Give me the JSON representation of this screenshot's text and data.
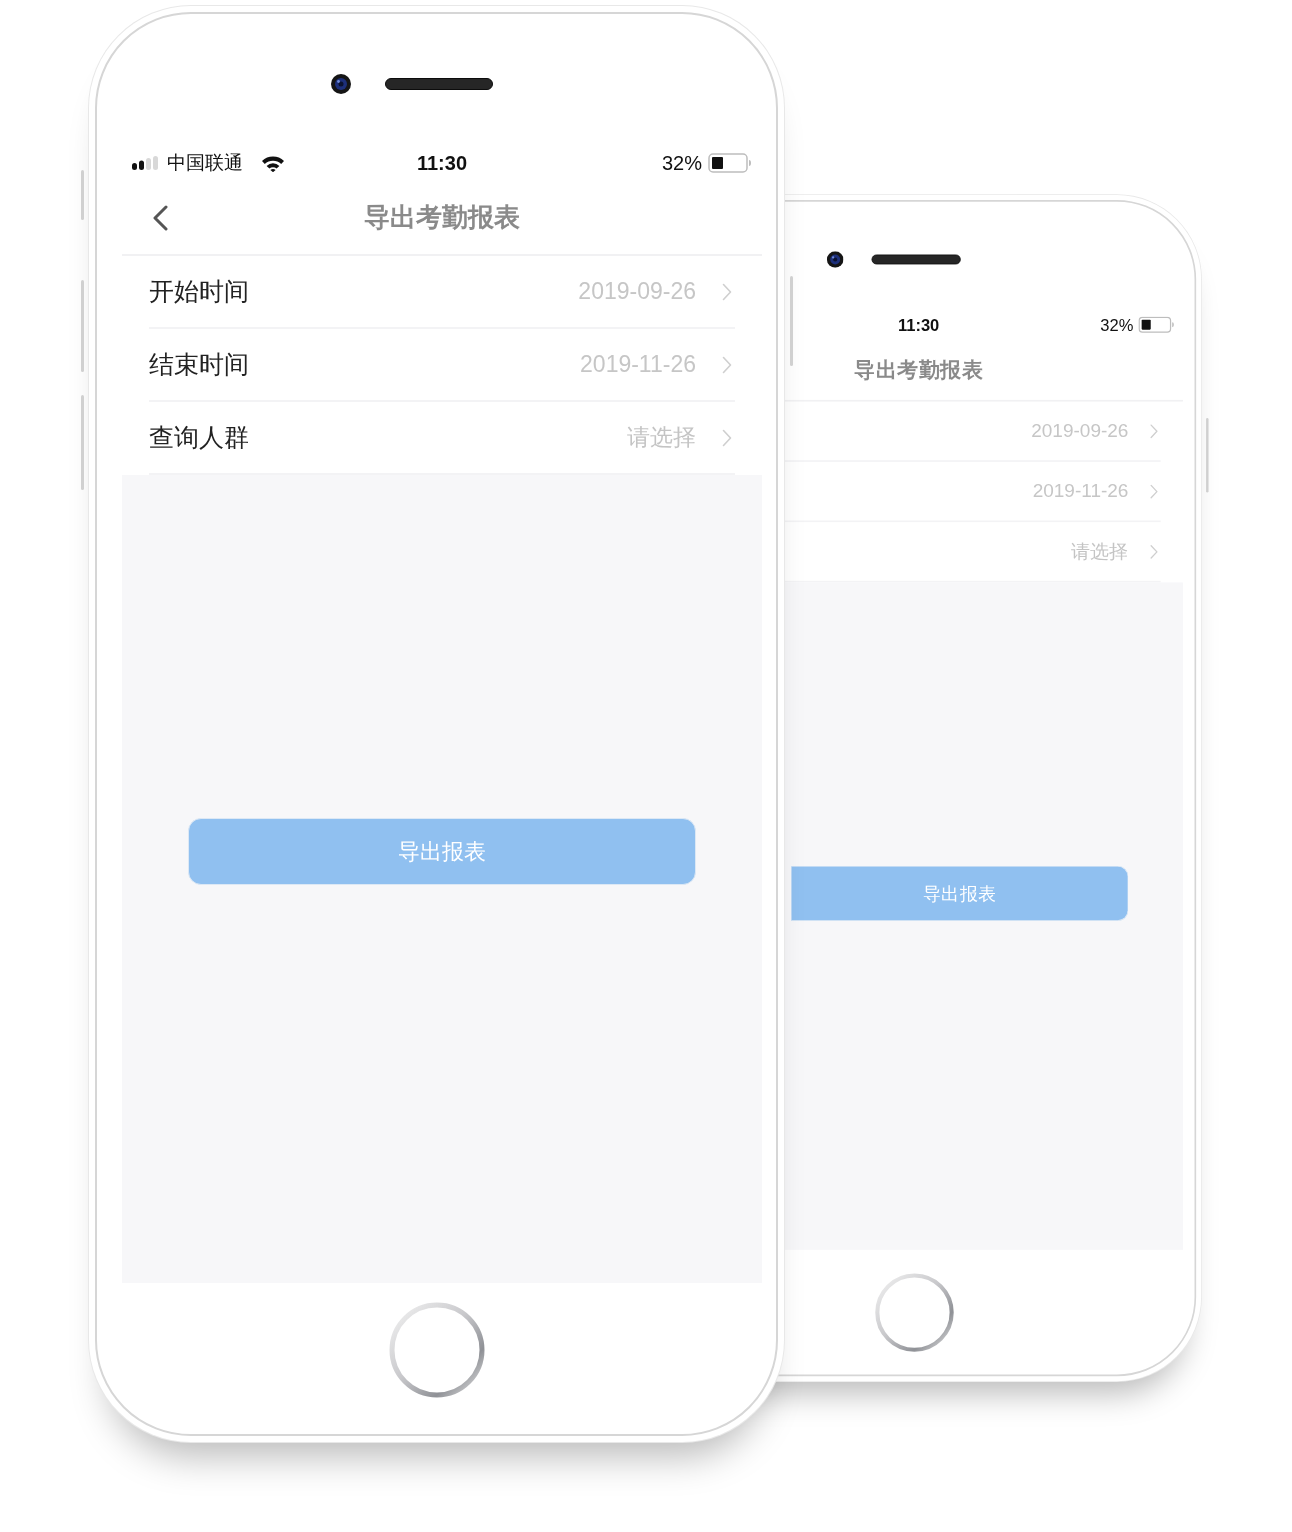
{
  "phones": [
    {
      "kind": "front",
      "status_bar": {
        "carrier": "中国联通",
        "time": "11:30",
        "battery": "32%"
      },
      "nav_bar": {
        "back": true,
        "title": "导出考勤报表"
      },
      "rows": [
        {
          "label": "开始时间",
          "value": "2019-09-26"
        },
        {
          "label": "结束时间",
          "value": "2019-11-26"
        },
        {
          "label": "查询人群",
          "placeholder": "请选择"
        }
      ],
      "button": "导出报表"
    },
    {
      "kind": "rear",
      "status_bar": {
        "time": "11:30",
        "battery": "32%"
      },
      "nav_bar": {
        "title": "导出考勤报表"
      },
      "rows": [
        {
          "value": "2019-09-26"
        },
        {
          "value": "2019-11-26"
        },
        {
          "placeholder": "请选择"
        }
      ],
      "button": "导出报表"
    }
  ]
}
